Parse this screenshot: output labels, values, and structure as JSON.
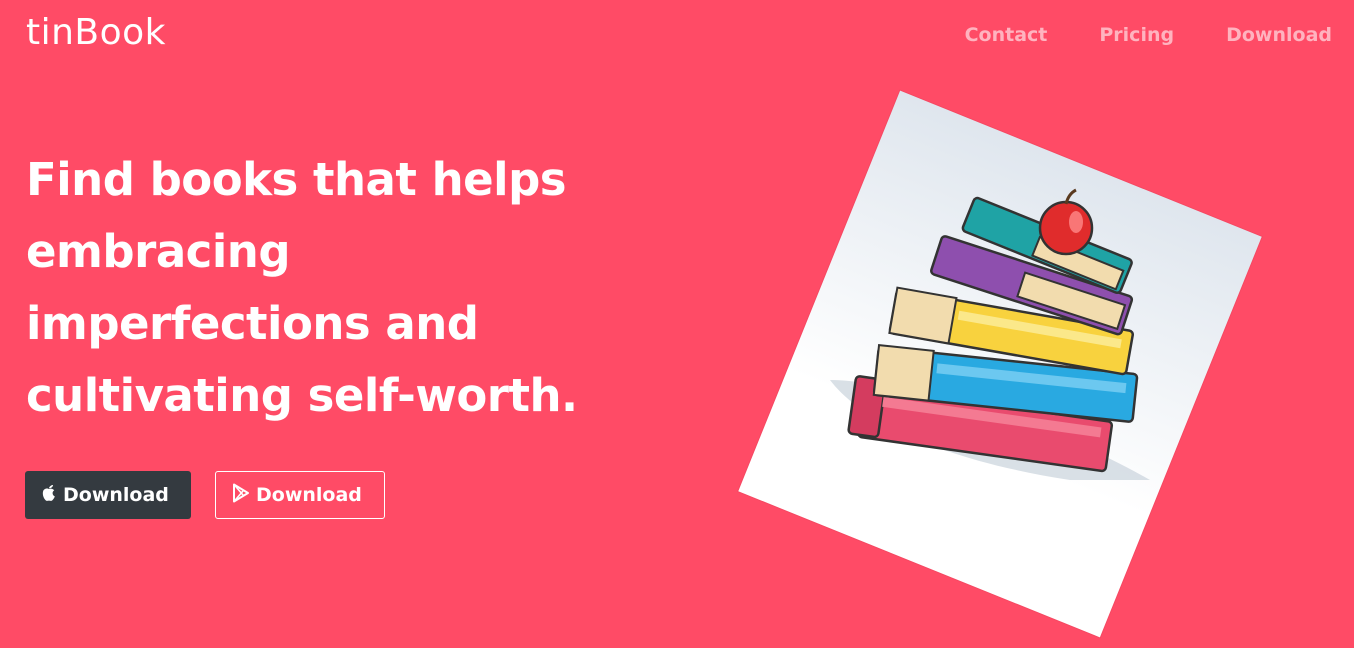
{
  "header": {
    "brand": "tinBook",
    "nav": [
      {
        "label": "Contact"
      },
      {
        "label": "Pricing"
      },
      {
        "label": "Download"
      }
    ]
  },
  "hero": {
    "headline_lines": [
      "Find books that helps",
      "embracing",
      "imperfections and",
      "cultivating self-worth."
    ],
    "buttons": {
      "apple": {
        "label": "Download",
        "icon": "apple-icon"
      },
      "play": {
        "label": "Download",
        "icon": "play-store-icon"
      }
    },
    "image": {
      "icon": "stack-of-books-with-apple-illustration"
    }
  },
  "colors": {
    "background": "#ff4b66",
    "nav_text": "#ffb3bf",
    "apple_button": "#343a40"
  }
}
